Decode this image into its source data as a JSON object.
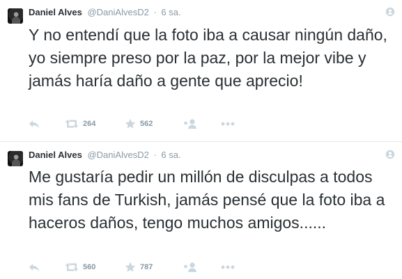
{
  "tweets": [
    {
      "name": "Daniel Alves",
      "handle": "@DaniAlvesD2",
      "separator": "·",
      "time": "6 sa.",
      "text": "Y no entendí que la foto iba a causar ningún daño, yo siempre preso por la paz, por la mejor vibe y jamás haría daño a gente que aprecio!",
      "retweets": "264",
      "favorites": "562"
    },
    {
      "name": "Daniel Alves",
      "handle": "@DaniAlvesD2",
      "separator": "·",
      "time": "6 sa.",
      "text": "Me gustaría pedir un millón de disculpas a todos mis fans de Turkish, jamás pensé que la foto iba a haceros daños, tengo muchos amigos......",
      "retweets": "560",
      "favorites": "787"
    }
  ],
  "icons": {
    "reply": "reply-icon",
    "retweet": "retweet-icon",
    "favorite": "star-icon",
    "follow": "follow-user-icon",
    "more": "more-icon",
    "corner": "follow-corner-icon"
  },
  "colors": {
    "text": "#292f33",
    "muted": "#8899a6",
    "icon": "#ccd6dd",
    "divider": "#e1e8ed"
  }
}
